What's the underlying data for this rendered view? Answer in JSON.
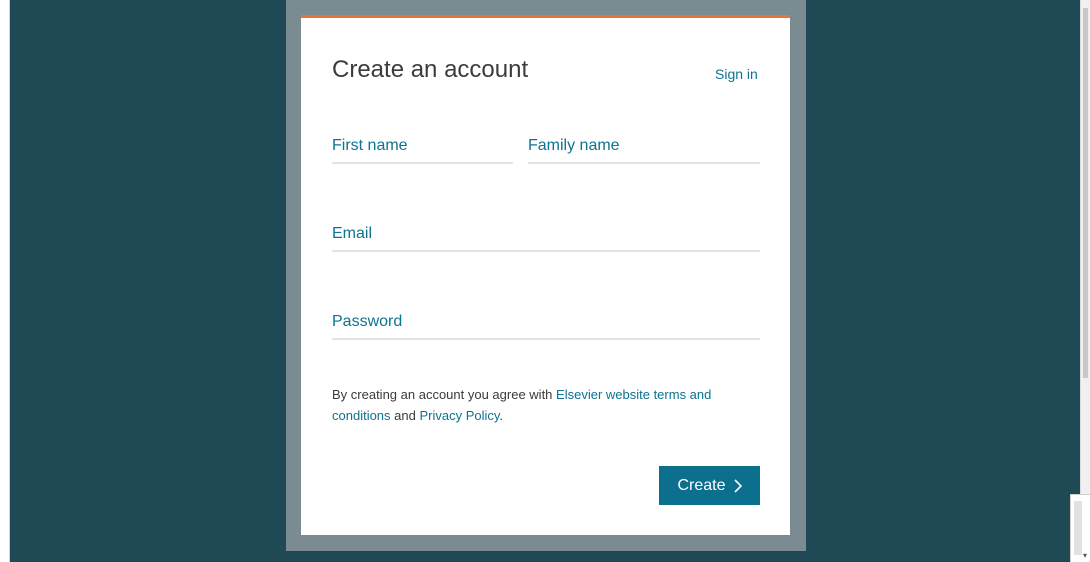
{
  "form": {
    "title": "Create an account",
    "sign_in_label": "Sign in",
    "fields": {
      "first_name": {
        "placeholder": "First name",
        "value": ""
      },
      "family_name": {
        "placeholder": "Family name",
        "value": ""
      },
      "email": {
        "placeholder": "Email",
        "value": ""
      },
      "password": {
        "placeholder": "Password",
        "value": ""
      }
    },
    "terms": {
      "prefix": "By creating an account you agree with ",
      "terms_link": "Elsevier website terms and conditions",
      "middle": " and ",
      "privacy_link": "Privacy Policy",
      "suffix": "."
    },
    "create_label": "Create",
    "create_icon": "chevron-right-icon"
  },
  "colors": {
    "page_background": "#1f4a55",
    "modal_frame": "#7b8b92",
    "accent_top_border": "#e9733a",
    "link": "#0c7391",
    "button": "#0c6f8e"
  }
}
